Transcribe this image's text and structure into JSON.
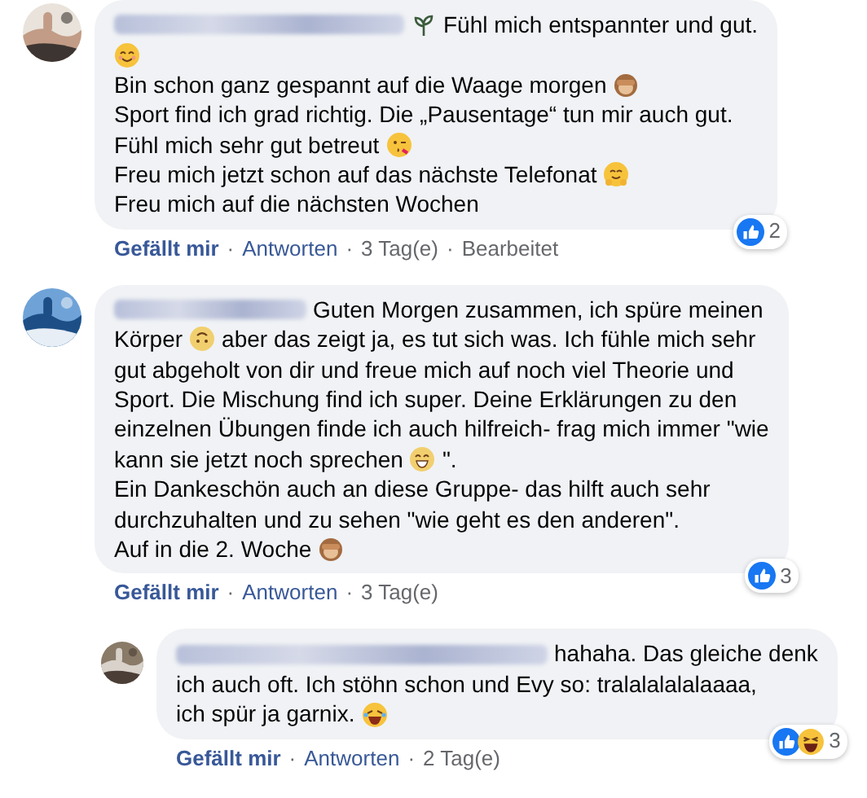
{
  "comments": [
    {
      "lines": [
        {
          "segments": [
            {
              "kind": "plant"
            },
            {
              "kind": "text",
              "text": "Fühl mich entspannter und gut."
            }
          ]
        },
        {
          "segments": [
            {
              "kind": "blush"
            }
          ]
        },
        {
          "segments": [
            {
              "kind": "text",
              "text": "Bin schon ganz gespannt auf die Waage morgen"
            },
            {
              "kind": "monkey"
            }
          ]
        },
        {
          "segments": [
            {
              "kind": "text",
              "text": "Sport find ich grad richtig. Die „Pausentage“ tun mir auch gut."
            }
          ]
        },
        {
          "segments": [
            {
              "kind": "text",
              "text": "Fühl mich sehr gut betreut"
            },
            {
              "kind": "kiss"
            }
          ]
        },
        {
          "segments": [
            {
              "kind": "text",
              "text": "Freu mich jetzt schon auf das nächste Telefonat"
            },
            {
              "kind": "hug"
            }
          ]
        },
        {
          "segments": [
            {
              "kind": "text",
              "text": "Freu mich auf die nächsten Wochen"
            }
          ]
        }
      ],
      "reactions": {
        "icons": [
          {
            "kind": "like"
          }
        ],
        "count": "2"
      },
      "actions": [
        {
          "kind": "like",
          "text": "Gefällt mir"
        },
        {
          "kind": "sep",
          "text": "·"
        },
        {
          "kind": "link",
          "text": "Antworten"
        },
        {
          "kind": "sep",
          "text": "·"
        },
        {
          "kind": "meta",
          "text": "3 Tag(e)"
        },
        {
          "kind": "sep",
          "text": "·"
        },
        {
          "kind": "meta",
          "text": "Bearbeitet"
        }
      ]
    },
    {
      "lines": [
        {
          "segments": [
            {
              "kind": "text",
              "text": "Guten Morgen zusammen, ich spüre meinen"
            }
          ]
        },
        {
          "segments": [
            {
              "kind": "text",
              "text": "Körper"
            },
            {
              "kind": "upside"
            },
            {
              "kind": "text",
              "text": "aber das zeigt ja, es tut sich was. Ich fühle mich sehr"
            }
          ]
        },
        {
          "segments": [
            {
              "kind": "text",
              "text": "gut abgeholt von dir und freue mich auf noch viel Theorie und"
            }
          ]
        },
        {
          "segments": [
            {
              "kind": "text",
              "text": "Sport. Die Mischung find ich super. Deine Erklärungen zu den"
            }
          ]
        },
        {
          "segments": [
            {
              "kind": "text",
              "text": "einzelnen Übungen finde ich auch hilfreich- frag mich immer \"wie"
            }
          ]
        },
        {
          "segments": [
            {
              "kind": "text",
              "text": "kann sie jetzt noch sprechen"
            },
            {
              "kind": "grin"
            },
            {
              "kind": "text",
              "text": "\"."
            }
          ]
        },
        {
          "segments": [
            {
              "kind": "text",
              "text": "Ein Dankeschön auch an diese Gruppe- das hilft auch sehr"
            }
          ]
        },
        {
          "segments": [
            {
              "kind": "text",
              "text": "durchzuhalten und zu sehen \"wie geht es den anderen\"."
            }
          ]
        },
        {
          "segments": [
            {
              "kind": "text",
              "text": "Auf in die 2. Woche"
            },
            {
              "kind": "monkey"
            }
          ]
        }
      ],
      "reactions": {
        "icons": [
          {
            "kind": "like"
          }
        ],
        "count": "3"
      },
      "actions": [
        {
          "kind": "like",
          "text": "Gefällt mir"
        },
        {
          "kind": "sep",
          "text": "·"
        },
        {
          "kind": "link",
          "text": "Antworten"
        },
        {
          "kind": "sep",
          "text": "·"
        },
        {
          "kind": "meta",
          "text": "3 Tag(e)"
        }
      ],
      "replies": [
        {
          "lines": [
            {
              "segments": [
                {
                  "kind": "text",
                  "text": "hahaha. Das gleiche denk"
                }
              ]
            },
            {
              "segments": [
                {
                  "kind": "text",
                  "text": "ich auch oft. Ich stöhn schon und Evy so: tralalalalalaaaa,"
                }
              ]
            },
            {
              "segments": [
                {
                  "kind": "text",
                  "text": "ich spür ja garnix."
                },
                {
                  "kind": "rofl"
                }
              ]
            }
          ],
          "reactions": {
            "icons": [
              {
                "kind": "like"
              },
              {
                "kind": "haha"
              }
            ],
            "count": "3"
          },
          "actions": [
            {
              "kind": "like",
              "text": "Gefällt mir"
            },
            {
              "kind": "sep",
              "text": "·"
            },
            {
              "kind": "link",
              "text": "Antworten"
            },
            {
              "kind": "sep",
              "text": "·"
            },
            {
              "kind": "meta",
              "text": "2 Tag(e)"
            }
          ]
        }
      ]
    }
  ]
}
